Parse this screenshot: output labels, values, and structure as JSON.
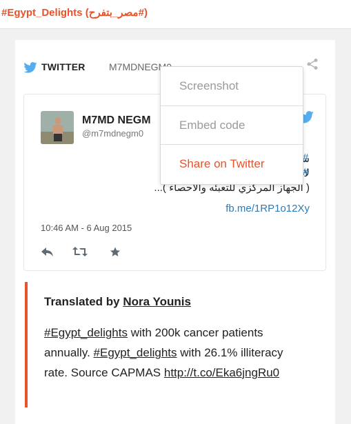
{
  "topbar": {
    "hashtag": "#Egypt_Delights (مصر_بتفرح#)"
  },
  "embed": {
    "source_label": "TWITTER",
    "account_handle": "M7MDNEGM0"
  },
  "tweet": {
    "author_name": "M7MD NEGM",
    "author_handle": "@m7mdnegm0",
    "text_lines": [
      "سرطان سنويا",
      "لاميه",
      "( الجهاز المركزي للتعبئه والاحصاء )..."
    ],
    "hash_fragments": [
      "#",
      "#"
    ],
    "link": "fb.me/1RP1o12Xy",
    "timestamp": "10:46 AM - 6 Aug 2015",
    "actions": [
      "reply-icon",
      "retweet-icon",
      "favorite-icon"
    ]
  },
  "share_menu": {
    "items": [
      "Screenshot",
      "Embed code",
      "Share on Twitter"
    ]
  },
  "translation": {
    "heading_prefix": "Translated by",
    "translator": "Nora Younis",
    "hashtag1": "#Egypt_delights",
    "text1": "with 200k cancer patients annually.",
    "hashtag2": "#Egypt_delights",
    "text2": "with 26.1% illiteracy rate. Source CAPMAS",
    "link": "http://t.co/Eka6jngRu0"
  },
  "colors": {
    "accent": "#e8532b",
    "twitter_blue": "#55acee",
    "link_blue": "#2b7bb9"
  }
}
